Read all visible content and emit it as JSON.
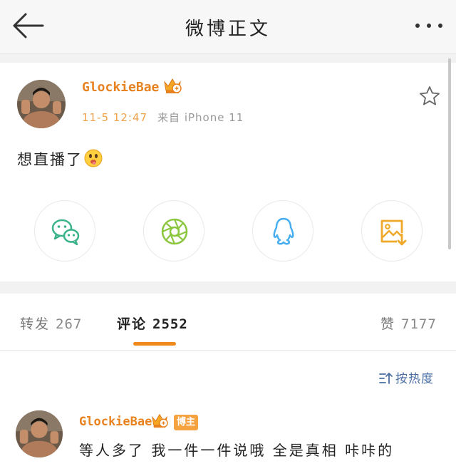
{
  "header": {
    "title": "微博正文"
  },
  "post": {
    "author": "GlockieBae",
    "time": "11-5 12:47",
    "source": "来自 iPhone 11",
    "text": "想直播了"
  },
  "share_targets": [
    "wechat",
    "wechat-moments",
    "qq",
    "save-image"
  ],
  "tabs": [
    {
      "label": "转发",
      "count": "267"
    },
    {
      "label": "评论",
      "count": "2552"
    },
    {
      "label": "赞",
      "count": "7177"
    }
  ],
  "comments": {
    "sort_label": "按热度",
    "items": [
      {
        "author": "GlockieBae",
        "badge": "博主",
        "text": "等人多了 我一件一件说哦 全是真相 咔咔的"
      }
    ]
  },
  "colors": {
    "accent": "#f08a1c",
    "username": "#e8821e",
    "link": "#4a6ea3"
  }
}
